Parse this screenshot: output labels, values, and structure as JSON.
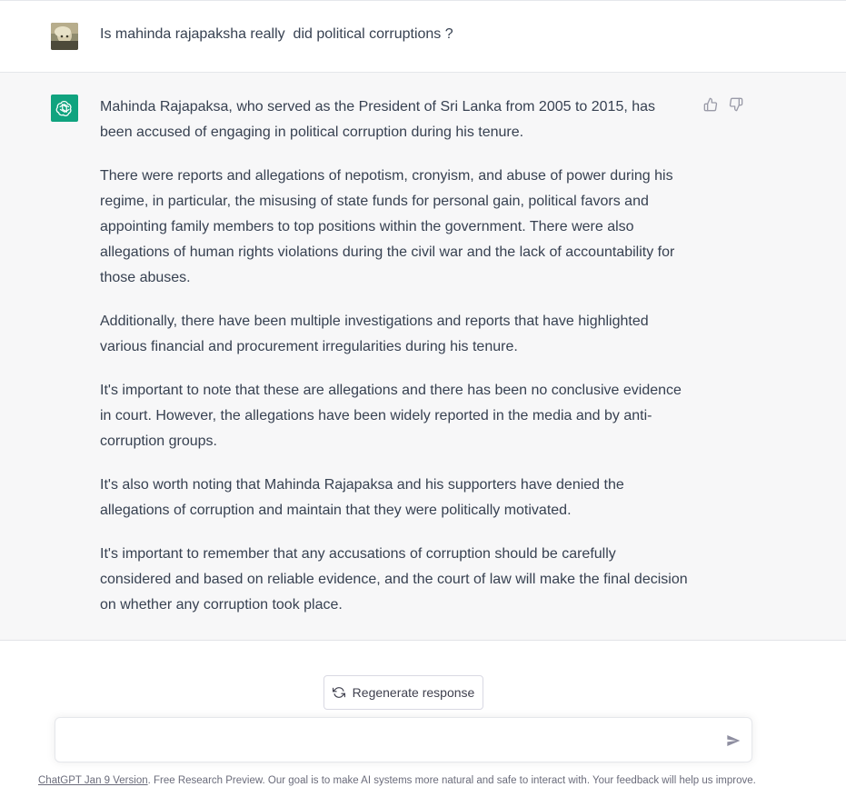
{
  "user_message": {
    "text": "Is mahinda rajapaksha really  did political corruptions ?"
  },
  "assistant_message": {
    "paragraphs": [
      "Mahinda Rajapaksa, who served as the President of Sri Lanka from 2005 to 2015, has been accused of engaging in political corruption during his tenure.",
      "There were reports and allegations of nepotism, cronyism, and abuse of power during his regime, in particular, the misusing of state funds for personal gain, political favors and appointing family members to top positions within the government. There were also allegations of human rights violations during the civil war and the lack of accountability for those abuses.",
      "Additionally, there have been multiple investigations and reports that have highlighted various financial and procurement irregularities during his tenure.",
      "It's important to note that these are allegations and there has been no conclusive evidence in court. However, the allegations have been widely reported in the media and by anti-corruption groups.",
      "It's also worth noting that Mahinda Rajapaksa and his supporters have denied the allegations of corruption and maintain that they were politically motivated.",
      "It's important to remember that any accusations of corruption should be carefully considered and based on reliable evidence, and the court of law will make the final decision on whether any corruption took place."
    ]
  },
  "icons": {
    "thumbs_up": "thumbs-up-icon",
    "thumbs_down": "thumbs-down-icon",
    "regenerate": "refresh-icon",
    "send": "paper-plane-icon",
    "assistant_logo": "openai-logo-icon"
  },
  "colors": {
    "assistant_bg": "#f7f7f8",
    "logo_bg": "#10a37f",
    "text": "#374151"
  },
  "regenerate_label": "Regenerate response",
  "composer": {
    "value": "",
    "placeholder": ""
  },
  "footer": {
    "link_text": "ChatGPT Jan 9 Version",
    "text": ". Free Research Preview. Our goal is to make AI systems more natural and safe to interact with. Your feedback will help us improve."
  }
}
